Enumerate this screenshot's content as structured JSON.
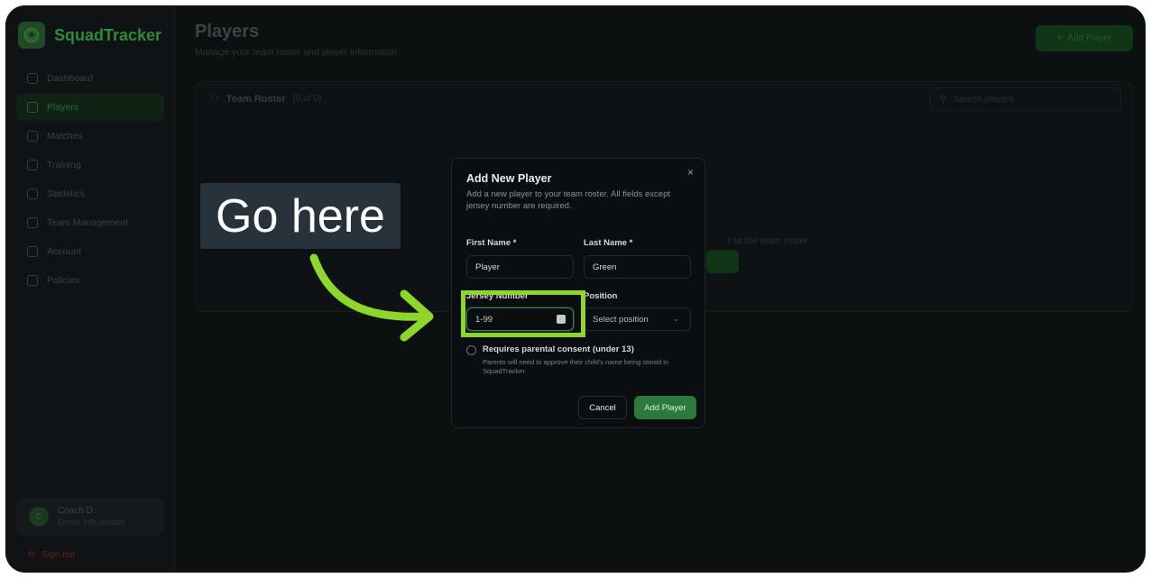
{
  "app": {
    "brand": "SquadTracker",
    "accent_color": "#2b7a3b",
    "annotation_color": "#8fd62a"
  },
  "sidebar": {
    "items": [
      {
        "label": "Dashboard",
        "icon": "home-icon"
      },
      {
        "label": "Players",
        "icon": "users-icon",
        "active": true
      },
      {
        "label": "Matches",
        "icon": "trophy-icon"
      },
      {
        "label": "Training",
        "icon": "training-icon"
      },
      {
        "label": "Statistics",
        "icon": "chart-icon"
      },
      {
        "label": "Team Management",
        "icon": "team-icon"
      },
      {
        "label": "Account",
        "icon": "user-icon"
      },
      {
        "label": "Policies",
        "icon": "document-icon"
      }
    ],
    "user": {
      "name": "Coach D.",
      "sub": "Demo info posted",
      "initial": "C"
    },
    "signout": "Sign out"
  },
  "page": {
    "title": "Players",
    "subtitle": "Manage your team roster and player information",
    "add_button": "Add Player",
    "roster_title": "Team Roster",
    "roster_count": "(0 of 0)",
    "search_placeholder": "Search players...",
    "empty_text": "r to the team roster."
  },
  "dialog": {
    "title": "Add New Player",
    "description": "Add a new player to your team roster. All fields except jersey number are required.",
    "close": "×",
    "first_name_label": "First Name *",
    "first_name_value": "Player",
    "last_name_label": "Last Name *",
    "last_name_value": "Green",
    "jersey_label": "Jersey Number",
    "jersey_placeholder": "1-99",
    "position_label": "Position",
    "position_placeholder": "Select position",
    "consent_label": "Requires parental consent (under 13)",
    "consent_desc": "Parents will need to approve their child's name being stored in SquadTracker",
    "cancel": "Cancel",
    "submit": "Add Player"
  },
  "annotation": {
    "callout": "Go here"
  }
}
